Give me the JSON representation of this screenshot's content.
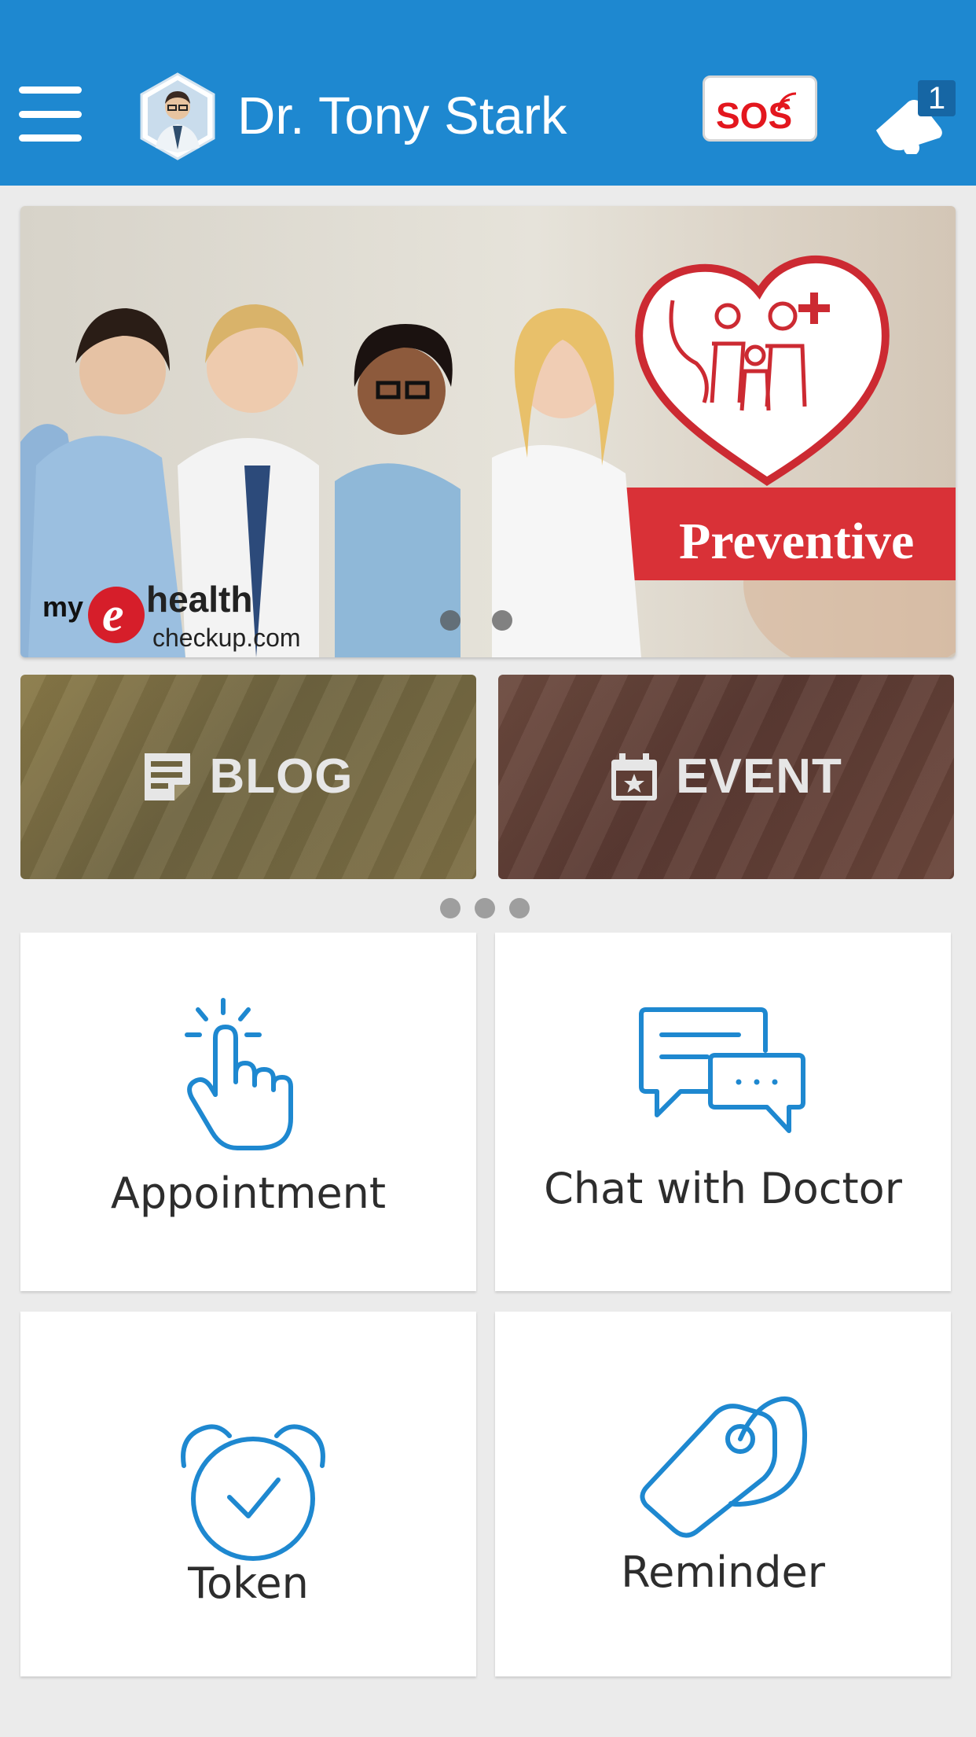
{
  "header": {
    "doctor_name": "Dr. Tony Stark",
    "sos_label": "SOS",
    "notification_count": "1"
  },
  "banner": {
    "logo_prefix": "my",
    "logo_e": "e",
    "logo_main": "health",
    "logo_sub": "checkup.com",
    "ribbon_text": "Preventive"
  },
  "categories": {
    "blog_label": "BLOG",
    "event_label": "EVENT"
  },
  "features": {
    "appointment_label": "Appointment",
    "chat_label": "Chat with Doctor",
    "token_label": "Token",
    "reminder_label": "Reminder"
  },
  "colors": {
    "primary": "#1e88d0",
    "sos_red": "#e3171e",
    "icon_blue": "#1e88d0"
  }
}
